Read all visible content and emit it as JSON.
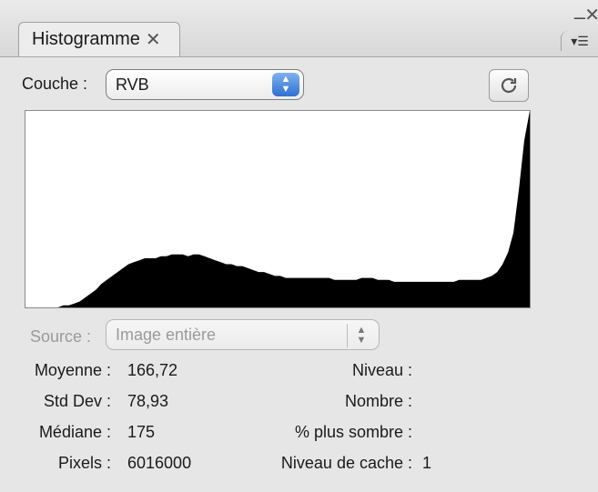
{
  "tab": {
    "title": "Histogramme",
    "close_glyph": "✕"
  },
  "window": {
    "minimize_glyph": "–",
    "close_glyph": "✕",
    "menu_glyph": "▾☰"
  },
  "channel": {
    "label": "Couche :",
    "value": "RVB"
  },
  "source": {
    "label": "Source :",
    "value": "Image entière"
  },
  "histogram": {
    "bins": [
      0,
      0,
      0,
      0,
      0,
      0,
      0,
      1,
      1,
      2,
      3,
      5,
      7,
      9,
      12,
      14,
      16,
      18,
      20,
      22,
      23,
      24,
      25,
      25,
      25,
      26,
      26,
      27,
      27,
      27,
      26,
      27,
      27,
      26,
      25,
      24,
      23,
      22,
      22,
      21,
      21,
      20,
      19,
      18,
      18,
      17,
      16,
      16,
      15,
      15,
      15,
      15,
      15,
      15,
      15,
      15,
      15,
      14,
      14,
      14,
      14,
      14,
      15,
      15,
      15,
      14,
      14,
      14,
      13,
      13,
      13,
      13,
      13,
      13,
      13,
      13,
      13,
      13,
      13,
      13,
      14,
      14,
      14,
      14,
      14,
      15,
      16,
      18,
      22,
      28,
      38,
      60,
      85,
      100
    ]
  },
  "stats_left": [
    {
      "label": "Moyenne :",
      "value": "166,72"
    },
    {
      "label": "Std Dev :",
      "value": "78,93"
    },
    {
      "label": "Médiane :",
      "value": "175"
    },
    {
      "label": "Pixels :",
      "value": "6016000"
    }
  ],
  "stats_right": [
    {
      "label": "Niveau :",
      "value": ""
    },
    {
      "label": "Nombre :",
      "value": ""
    },
    {
      "label": "% plus sombre :",
      "value": ""
    },
    {
      "label": "Niveau de cache :",
      "value": "1"
    }
  ]
}
